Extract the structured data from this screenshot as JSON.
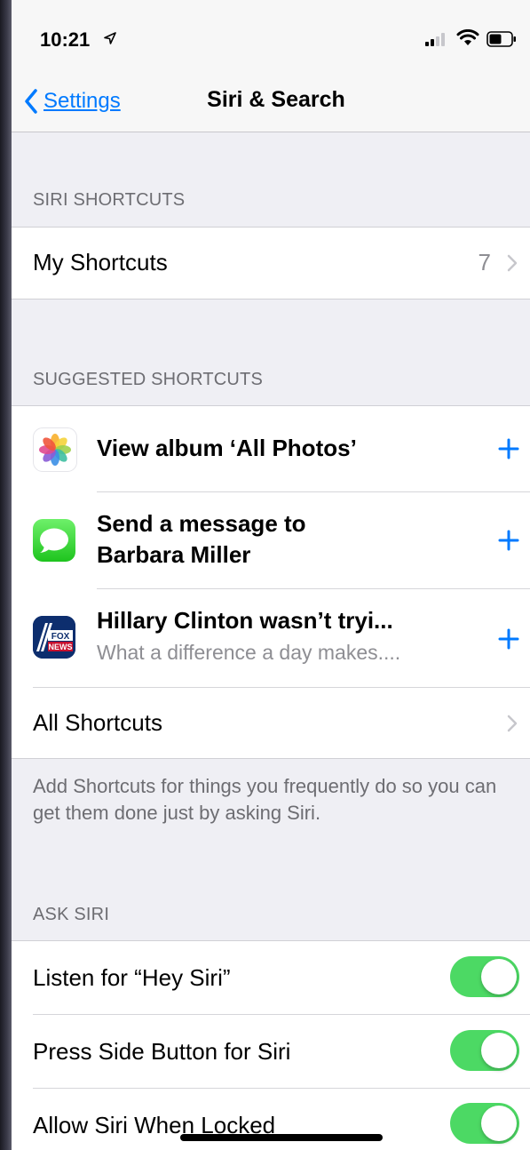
{
  "status_bar": {
    "time": "10:21"
  },
  "nav": {
    "back_label": "Settings",
    "title": "Siri & Search"
  },
  "siri_shortcuts": {
    "header": "SIRI SHORTCUTS",
    "my_shortcuts_label": "My Shortcuts",
    "my_shortcuts_count": "7"
  },
  "suggested": {
    "header": "SUGGESTED SHORTCUTS",
    "items": [
      {
        "title": "View album ‘All Photos’",
        "subtitle": "",
        "icon": "photos-app-icon"
      },
      {
        "title_line1": "Send a message to",
        "title_line2": "Barbara Miller",
        "icon": "messages-app-icon"
      },
      {
        "title": "Hillary Clinton wasn’t tryi...",
        "subtitle": "What a difference a day makes....",
        "icon": "fox-news-app-icon"
      }
    ],
    "all_shortcuts_label": "All Shortcuts",
    "footer": "Add Shortcuts for things you frequently do so you can get them done just by asking Siri."
  },
  "ask_siri": {
    "header": "ASK SIRI",
    "toggles": [
      {
        "label": "Listen for “Hey Siri”",
        "on": true
      },
      {
        "label": "Press Side Button for Siri",
        "on": true
      },
      {
        "label": "Allow Siri When Locked",
        "on": true
      }
    ]
  },
  "colors": {
    "accent": "#007aff",
    "toggle_on": "#4cd964",
    "group_bg": "#efeff4"
  }
}
